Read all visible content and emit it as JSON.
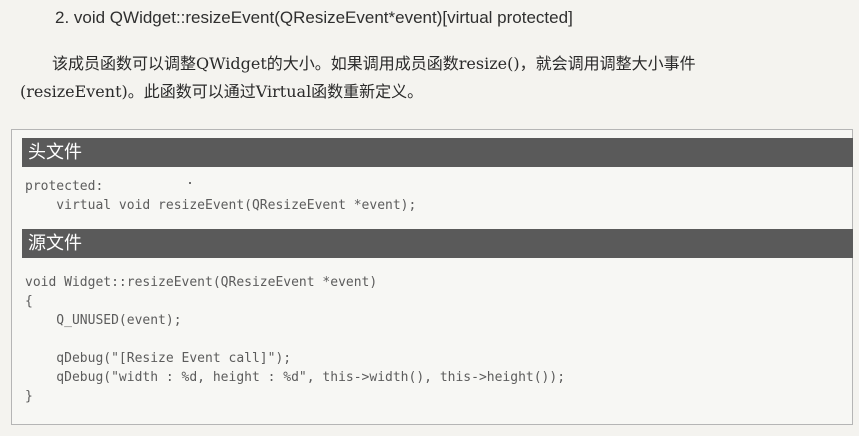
{
  "heading": "2. void QWidget::resizeEvent(QResizeEvent*event)[virtual protected]",
  "paragraph": {
    "line1": "该成员函数可以调整QWidget的大小。如果调用成员函数resize()，就会调用调整大小事件",
    "line2": "(resizeEvent)。此函数可以通过Virtual函数重新定义。"
  },
  "header_section": {
    "title": "头文件",
    "code": "protected:\n    virtual void resizeEvent(QResizeEvent *event);"
  },
  "source_section": {
    "title": "源文件",
    "code": "void Widget::resizeEvent(QResizeEvent *event)\n{\n    Q_UNUSED(event);\n\n    qDebug(\"[Resize Event call]\");\n    qDebug(\"width : %d, height : %d\", this->width(), this->height());\n}"
  }
}
